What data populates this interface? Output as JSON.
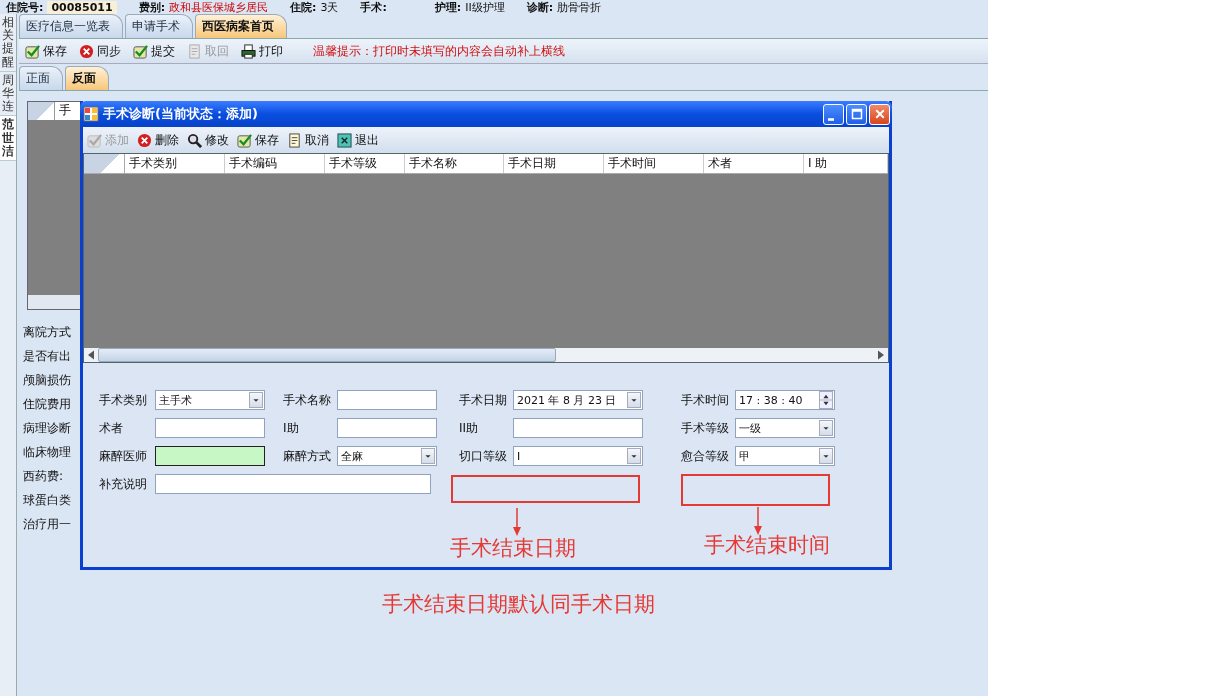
{
  "header": [
    {
      "label": "住院号:",
      "value": "00085011",
      "kind": "box"
    },
    {
      "label": "费别:",
      "value": "政和县医保城乡居民",
      "kind": "alert"
    },
    {
      "label": "住院:",
      "value": "3天",
      "kind": "plain"
    },
    {
      "label": "手术:"
    },
    {
      "label": "护理:",
      "value": "II级护理",
      "kind": "plain"
    },
    {
      "label": "诊断:",
      "value": "肋骨骨折",
      "kind": "plain"
    }
  ],
  "side_tabs": [
    {
      "label": "相关提醒",
      "selected": false
    },
    {
      "label": "周华连",
      "selected": false
    },
    {
      "label": "范世洁",
      "selected": true
    }
  ],
  "tabs": [
    {
      "label": "医疗信息一览表",
      "selected": false
    },
    {
      "label": "申请手术",
      "selected": false
    },
    {
      "label": "西医病案首页",
      "selected": true
    }
  ],
  "toolbar": [
    {
      "label": "保存",
      "kind": "check",
      "disabled": false
    },
    {
      "label": "同步",
      "kind": "cross",
      "disabled": false
    },
    {
      "label": "提交",
      "kind": "check",
      "disabled": false
    },
    {
      "label": "取回",
      "kind": "document",
      "disabled": true
    },
    {
      "label": "打印",
      "kind": "printer",
      "disabled": false
    }
  ],
  "notice": "温馨提示：打印时未填写的内容会自动补上横线",
  "sub_tabs": [
    {
      "label": "正面",
      "selected": false
    },
    {
      "label": "反面",
      "selected": true
    }
  ],
  "background_form": {
    "grid_header": "手",
    "labels": [
      "离院方式",
      "是否有出",
      "颅脑损伤",
      "住院费用",
      "病理诊断",
      "临床物理",
      "西药费:",
      "球蛋白类",
      "治疗用一"
    ]
  },
  "dialog": {
    "title": "手术诊断(当前状态：添加)",
    "toolbar": [
      {
        "label": "添加",
        "kind": "check",
        "disabled": true
      },
      {
        "label": "删除",
        "kind": "cross",
        "disabled": false
      },
      {
        "label": "修改",
        "kind": "magnifier",
        "disabled": false
      },
      {
        "label": "保存",
        "kind": "check",
        "disabled": false
      },
      {
        "label": "取消",
        "kind": "document",
        "disabled": false
      },
      {
        "label": "退出",
        "kind": "exit",
        "disabled": false
      }
    ],
    "columns": [
      "手术类别",
      "手术编码",
      "手术等级",
      "手术名称",
      "手术日期",
      "手术时间",
      "术者",
      "I 助"
    ],
    "form": [
      [
        {
          "label": "手术类别",
          "kind": "combo",
          "value": "主手术"
        },
        {
          "label": "手术名称",
          "kind": "text",
          "required": false
        },
        {
          "label": "手术日期",
          "kind": "date",
          "value": "2021 年 8 月 23 日"
        },
        {
          "label": "手术时间",
          "kind": "time",
          "value": "17 : 38 : 40"
        }
      ],
      [
        {
          "label": "术者",
          "kind": "text",
          "required": false
        },
        {
          "label": "I助",
          "kind": "text",
          "required": false
        },
        {
          "label": "II助",
          "kind": "text",
          "required": false
        },
        {
          "label": "手术等级",
          "kind": "combo",
          "value": "一级"
        }
      ],
      [
        {
          "label": "麻醉医师",
          "kind": "text",
          "required": true
        },
        {
          "label": "麻醉方式",
          "kind": "combo",
          "value": "全麻"
        },
        {
          "label": "切口等级",
          "kind": "combo",
          "value": "Ⅰ"
        },
        {
          "label": "愈合等级",
          "kind": "combo",
          "value": "甲"
        }
      ],
      [
        {
          "label": "补充说明",
          "kind": "wide",
          "required": false
        }
      ]
    ]
  },
  "annotations": {
    "markers": [
      "手术结束日期",
      "手术结束时间"
    ],
    "caption": "手术结束日期默认同手术日期"
  }
}
